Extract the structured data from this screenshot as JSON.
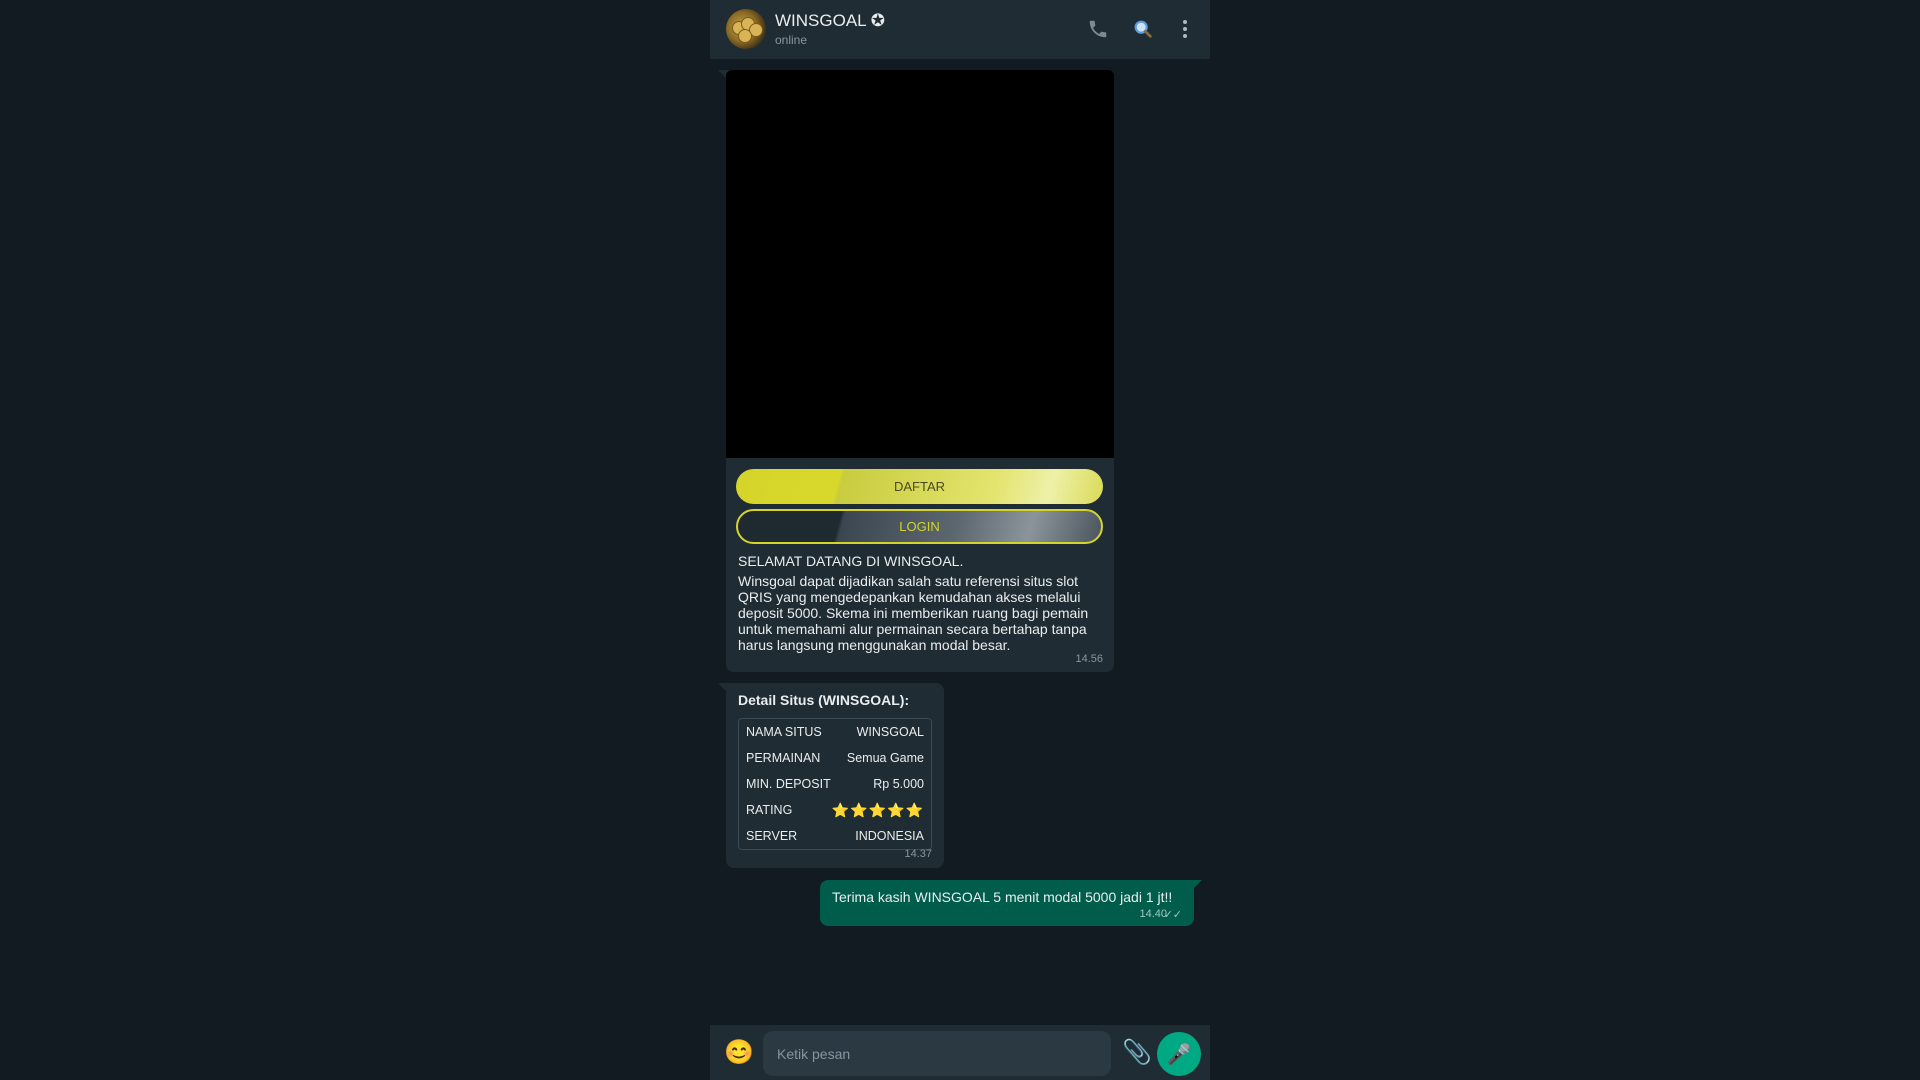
{
  "header": {
    "title": "WINSGOAL ✪",
    "status": "online",
    "icons": {
      "call": "phone-icon",
      "search": "search-icon",
      "menu": "more-vertical-icon"
    }
  },
  "messages": {
    "promo": {
      "register_label": "DAFTAR",
      "login_label": "LOGIN",
      "heading": "SELAMAT DATANG DI WINSGOAL.",
      "body": "Winsgoal dapat dijadikan salah satu referensi situs slot QRIS yang mengedepankan kemudahan akses melalui deposit 5000. Skema ini memberikan ruang bagi pemain untuk memahami alur permainan secara bertahap tanpa harus langsung menggunakan modal besar.",
      "time": "14.56"
    },
    "details": {
      "title": "Detail Situs (WINSGOAL):",
      "rows": [
        {
          "label": "NAMA SITUS",
          "value": "WINSGOAL"
        },
        {
          "label": "PERMAINAN",
          "value": "Semua Game"
        },
        {
          "label": "MIN. DEPOSIT",
          "value": "Rp 5.000"
        },
        {
          "label": "RATING",
          "value": "⭐⭐⭐⭐⭐"
        },
        {
          "label": "SERVER",
          "value": "INDONESIA"
        }
      ],
      "time": "14.37"
    },
    "reply": {
      "text": "Terima kasih WINSGOAL 5 menit modal 5000 jadi 1 jt!!",
      "time": "14.40",
      "ticks": "✓✓"
    }
  },
  "footer": {
    "placeholder": "Ketik pesan",
    "icons": {
      "emoji": "emoji-icon",
      "attach": "paperclip-icon",
      "mic": "microphone-icon"
    }
  },
  "colors": {
    "background": "#111b21",
    "panel": "#202c33",
    "incoming_bubble": "#202c33",
    "outgoing_bubble": "#005c4b",
    "accent": "#00a884",
    "button_yellow": "#d4d42a"
  }
}
